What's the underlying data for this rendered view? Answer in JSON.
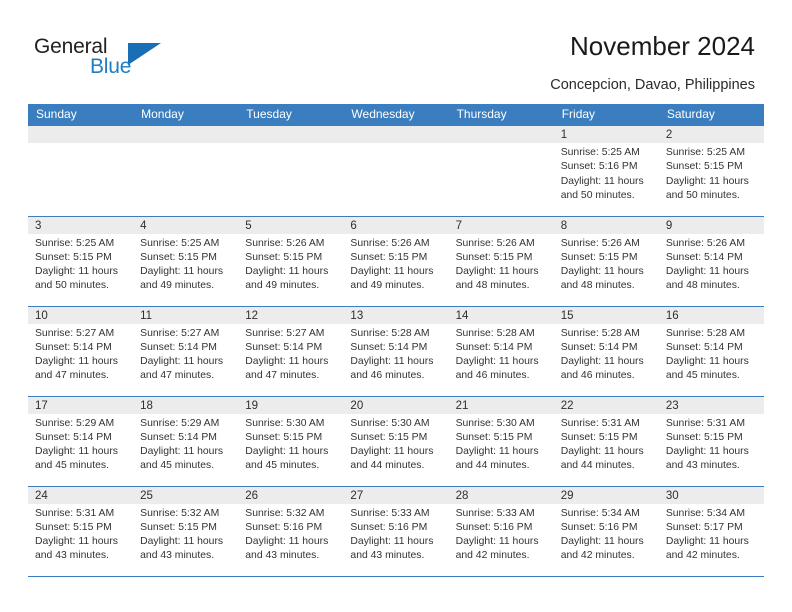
{
  "brand": {
    "name_part1": "General",
    "name_part2": "Blue",
    "accent_color": "#1a6eb5",
    "text_color": "#231f20"
  },
  "header": {
    "title": "November 2024",
    "location": "Concepcion, Davao, Philippines"
  },
  "theme": {
    "header_row_bg": "#3a7ebf",
    "daynum_band_bg": "#ececec",
    "cell_bg": "#ffffff",
    "row_divider": "#3a7ebf",
    "body_text": "#333333"
  },
  "weekday_headers": [
    "Sunday",
    "Monday",
    "Tuesday",
    "Wednesday",
    "Thursday",
    "Friday",
    "Saturday"
  ],
  "weeks": [
    [
      {
        "day": "",
        "lines": []
      },
      {
        "day": "",
        "lines": []
      },
      {
        "day": "",
        "lines": []
      },
      {
        "day": "",
        "lines": []
      },
      {
        "day": "",
        "lines": []
      },
      {
        "day": "1",
        "lines": [
          "Sunrise: 5:25 AM",
          "Sunset: 5:16 PM",
          "Daylight: 11 hours",
          "and 50 minutes."
        ]
      },
      {
        "day": "2",
        "lines": [
          "Sunrise: 5:25 AM",
          "Sunset: 5:15 PM",
          "Daylight: 11 hours",
          "and 50 minutes."
        ]
      }
    ],
    [
      {
        "day": "3",
        "lines": [
          "Sunrise: 5:25 AM",
          "Sunset: 5:15 PM",
          "Daylight: 11 hours",
          "and 50 minutes."
        ]
      },
      {
        "day": "4",
        "lines": [
          "Sunrise: 5:25 AM",
          "Sunset: 5:15 PM",
          "Daylight: 11 hours",
          "and 49 minutes."
        ]
      },
      {
        "day": "5",
        "lines": [
          "Sunrise: 5:26 AM",
          "Sunset: 5:15 PM",
          "Daylight: 11 hours",
          "and 49 minutes."
        ]
      },
      {
        "day": "6",
        "lines": [
          "Sunrise: 5:26 AM",
          "Sunset: 5:15 PM",
          "Daylight: 11 hours",
          "and 49 minutes."
        ]
      },
      {
        "day": "7",
        "lines": [
          "Sunrise: 5:26 AM",
          "Sunset: 5:15 PM",
          "Daylight: 11 hours",
          "and 48 minutes."
        ]
      },
      {
        "day": "8",
        "lines": [
          "Sunrise: 5:26 AM",
          "Sunset: 5:15 PM",
          "Daylight: 11 hours",
          "and 48 minutes."
        ]
      },
      {
        "day": "9",
        "lines": [
          "Sunrise: 5:26 AM",
          "Sunset: 5:14 PM",
          "Daylight: 11 hours",
          "and 48 minutes."
        ]
      }
    ],
    [
      {
        "day": "10",
        "lines": [
          "Sunrise: 5:27 AM",
          "Sunset: 5:14 PM",
          "Daylight: 11 hours",
          "and 47 minutes."
        ]
      },
      {
        "day": "11",
        "lines": [
          "Sunrise: 5:27 AM",
          "Sunset: 5:14 PM",
          "Daylight: 11 hours",
          "and 47 minutes."
        ]
      },
      {
        "day": "12",
        "lines": [
          "Sunrise: 5:27 AM",
          "Sunset: 5:14 PM",
          "Daylight: 11 hours",
          "and 47 minutes."
        ]
      },
      {
        "day": "13",
        "lines": [
          "Sunrise: 5:28 AM",
          "Sunset: 5:14 PM",
          "Daylight: 11 hours",
          "and 46 minutes."
        ]
      },
      {
        "day": "14",
        "lines": [
          "Sunrise: 5:28 AM",
          "Sunset: 5:14 PM",
          "Daylight: 11 hours",
          "and 46 minutes."
        ]
      },
      {
        "day": "15",
        "lines": [
          "Sunrise: 5:28 AM",
          "Sunset: 5:14 PM",
          "Daylight: 11 hours",
          "and 46 minutes."
        ]
      },
      {
        "day": "16",
        "lines": [
          "Sunrise: 5:28 AM",
          "Sunset: 5:14 PM",
          "Daylight: 11 hours",
          "and 45 minutes."
        ]
      }
    ],
    [
      {
        "day": "17",
        "lines": [
          "Sunrise: 5:29 AM",
          "Sunset: 5:14 PM",
          "Daylight: 11 hours",
          "and 45 minutes."
        ]
      },
      {
        "day": "18",
        "lines": [
          "Sunrise: 5:29 AM",
          "Sunset: 5:14 PM",
          "Daylight: 11 hours",
          "and 45 minutes."
        ]
      },
      {
        "day": "19",
        "lines": [
          "Sunrise: 5:30 AM",
          "Sunset: 5:15 PM",
          "Daylight: 11 hours",
          "and 45 minutes."
        ]
      },
      {
        "day": "20",
        "lines": [
          "Sunrise: 5:30 AM",
          "Sunset: 5:15 PM",
          "Daylight: 11 hours",
          "and 44 minutes."
        ]
      },
      {
        "day": "21",
        "lines": [
          "Sunrise: 5:30 AM",
          "Sunset: 5:15 PM",
          "Daylight: 11 hours",
          "and 44 minutes."
        ]
      },
      {
        "day": "22",
        "lines": [
          "Sunrise: 5:31 AM",
          "Sunset: 5:15 PM",
          "Daylight: 11 hours",
          "and 44 minutes."
        ]
      },
      {
        "day": "23",
        "lines": [
          "Sunrise: 5:31 AM",
          "Sunset: 5:15 PM",
          "Daylight: 11 hours",
          "and 43 minutes."
        ]
      }
    ],
    [
      {
        "day": "24",
        "lines": [
          "Sunrise: 5:31 AM",
          "Sunset: 5:15 PM",
          "Daylight: 11 hours",
          "and 43 minutes."
        ]
      },
      {
        "day": "25",
        "lines": [
          "Sunrise: 5:32 AM",
          "Sunset: 5:15 PM",
          "Daylight: 11 hours",
          "and 43 minutes."
        ]
      },
      {
        "day": "26",
        "lines": [
          "Sunrise: 5:32 AM",
          "Sunset: 5:16 PM",
          "Daylight: 11 hours",
          "and 43 minutes."
        ]
      },
      {
        "day": "27",
        "lines": [
          "Sunrise: 5:33 AM",
          "Sunset: 5:16 PM",
          "Daylight: 11 hours",
          "and 43 minutes."
        ]
      },
      {
        "day": "28",
        "lines": [
          "Sunrise: 5:33 AM",
          "Sunset: 5:16 PM",
          "Daylight: 11 hours",
          "and 42 minutes."
        ]
      },
      {
        "day": "29",
        "lines": [
          "Sunrise: 5:34 AM",
          "Sunset: 5:16 PM",
          "Daylight: 11 hours",
          "and 42 minutes."
        ]
      },
      {
        "day": "30",
        "lines": [
          "Sunrise: 5:34 AM",
          "Sunset: 5:17 PM",
          "Daylight: 11 hours",
          "and 42 minutes."
        ]
      }
    ]
  ]
}
